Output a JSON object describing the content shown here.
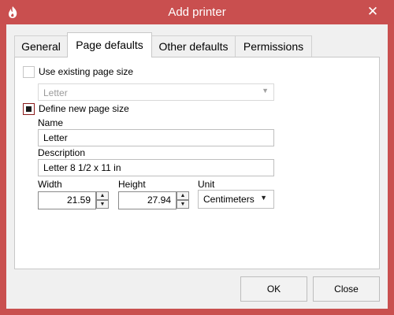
{
  "window": {
    "title": "Add printer",
    "app_icon": "printer-app-icon",
    "close_glyph": "✕",
    "accent_color": "#c94f4f"
  },
  "tabs": [
    {
      "label": "General",
      "active": false
    },
    {
      "label": "Page defaults",
      "active": true
    },
    {
      "label": "Other defaults",
      "active": false
    },
    {
      "label": "Permissions",
      "active": false
    }
  ],
  "page_defaults": {
    "use_existing": {
      "label": "Use existing page size",
      "checked": false
    },
    "existing_size": {
      "value": "Letter",
      "enabled": false
    },
    "define_new": {
      "label": "Define new page size",
      "checked": true
    },
    "name": {
      "label": "Name",
      "value": "Letter"
    },
    "description": {
      "label": "Description",
      "value": "Letter 8 1/2 x 11 in"
    },
    "width": {
      "label": "Width",
      "value": "21.59"
    },
    "height": {
      "label": "Height",
      "value": "27.94"
    },
    "unit": {
      "label": "Unit",
      "value": "Centimeters"
    }
  },
  "buttons": {
    "ok": "OK",
    "close": "Close"
  }
}
